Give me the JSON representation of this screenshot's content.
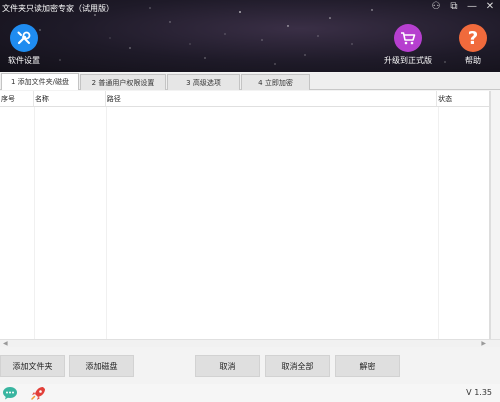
{
  "app": {
    "title": "文件夹只读加密专家（试用版）"
  },
  "window_controls": [
    {
      "name": "skin-icon",
      "glyph": "⚇"
    },
    {
      "name": "restore-icon",
      "glyph": "⧉"
    },
    {
      "name": "minimize-icon",
      "glyph": "—"
    },
    {
      "name": "close-icon",
      "glyph": "✕"
    }
  ],
  "toolbar": {
    "settings_label": "软件设置",
    "upgrade_label": "升级到正式版",
    "help_label": "帮助"
  },
  "colors": {
    "settings_accent": "#1f8cf0",
    "upgrade_accent": "#b63fcf",
    "help_accent": "#f06a3c"
  },
  "tabs": [
    {
      "label": "1 添加文件夹/磁盘",
      "active": true
    },
    {
      "label": "2 普通用户权限设置",
      "active": false
    },
    {
      "label": "3 高级选项",
      "active": false
    },
    {
      "label": "4 立即加密",
      "active": false
    }
  ],
  "table": {
    "columns": [
      "序号",
      "名称",
      "路径",
      "状态"
    ],
    "rows": []
  },
  "buttons": {
    "add_folder": "添加文件夹",
    "add_disk": "添加磁盘",
    "cancel": "取消",
    "cancel_all": "取消全部",
    "decrypt": "解密"
  },
  "status": {
    "version": "V 1.35"
  }
}
